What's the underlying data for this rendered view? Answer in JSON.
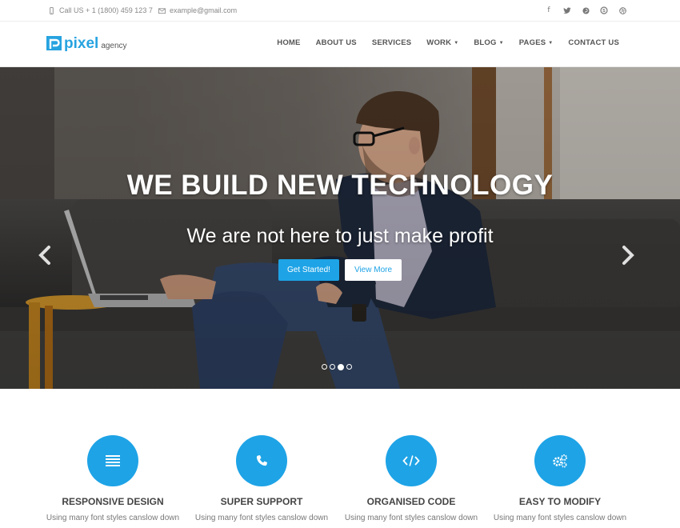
{
  "topbar": {
    "phone": "Call US + 1 (1800) 459 123 7",
    "email": "example@gmail.com",
    "social_icons": [
      "facebook-icon",
      "twitter-icon",
      "pinterest-icon",
      "skype-icon",
      "dribbble-icon"
    ]
  },
  "header": {
    "logo_name": "pixel",
    "logo_sub": "agency",
    "nav": [
      {
        "label": "HOME"
      },
      {
        "label": "ABOUT US"
      },
      {
        "label": "SERVICES"
      },
      {
        "label": "WORK",
        "dropdown": true
      },
      {
        "label": "BLOG",
        "dropdown": true
      },
      {
        "label": "PAGES",
        "dropdown": true
      },
      {
        "label": "CONTACT US"
      }
    ]
  },
  "hero": {
    "title": "WE BUILD NEW TECHNOLOGY",
    "subtitle": "We are not here to just make profit",
    "primary_button": "Get Started!",
    "secondary_button": "View More",
    "slide_count": 4,
    "active_slide": 3
  },
  "features": [
    {
      "icon": "list-icon",
      "title": "RESPONSIVE DESIGN",
      "desc": "Using many font styles canslow down"
    },
    {
      "icon": "phone-icon",
      "title": "SUPER SUPPORT",
      "desc": "Using many font styles canslow down"
    },
    {
      "icon": "code-icon",
      "title": "ORGANISED CODE",
      "desc": "Using many font styles canslow down"
    },
    {
      "icon": "gears-icon",
      "title": "EASY TO MODIFY",
      "desc": "Using many font styles canslow down"
    }
  ],
  "colors": {
    "accent": "#1ea3e6",
    "logo": "#27a3e0"
  }
}
